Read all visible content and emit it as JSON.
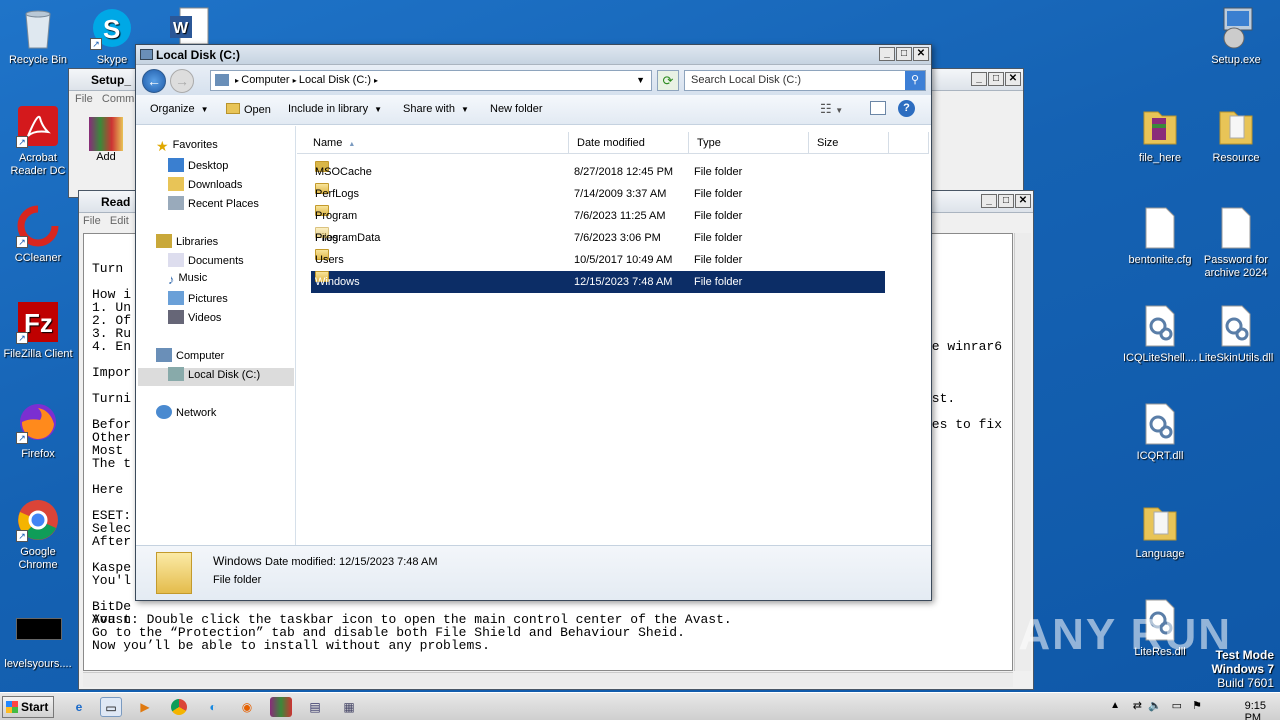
{
  "desktop_icons_left": [
    {
      "label": "Recycle Bin",
      "icon": "recycle-bin-icon"
    },
    {
      "label": "Acrobat Reader DC",
      "icon": "acrobat-icon"
    },
    {
      "label": "CCleaner",
      "icon": "ccleaner-icon"
    },
    {
      "label": "FileZilla Client",
      "icon": "filezilla-icon"
    },
    {
      "label": "Firefox",
      "icon": "firefox-icon"
    },
    {
      "label": "Google Chrome",
      "icon": "chrome-icon"
    },
    {
      "label": "levelsyours....",
      "icon": "black-file-icon"
    }
  ],
  "desktop_icons_top": [
    {
      "label": "Skype",
      "icon": "skype-icon"
    }
  ],
  "desktop_icons_right": [
    {
      "label": "Setup.exe",
      "icon": "setup-icon"
    },
    {
      "label": "file_here",
      "icon": "winrar-folder-icon"
    },
    {
      "label": "Resource",
      "icon": "folder-icon"
    },
    {
      "label": "bentonite.cfg",
      "icon": "file-icon"
    },
    {
      "label": "Password for archive 2024",
      "icon": "file-icon"
    },
    {
      "label": "ICQLiteShell....",
      "icon": "dll-icon"
    },
    {
      "label": "LiteSkinUtils.dll",
      "icon": "dll-icon"
    },
    {
      "label": "ICQRT.dll",
      "icon": "dll-icon"
    },
    {
      "label": "Language",
      "icon": "folder-icon"
    },
    {
      "label": "LiteRes.dll",
      "icon": "dll-icon"
    }
  ],
  "setup_window": {
    "title": "Setup_",
    "menu": [
      "File",
      "Comm"
    ],
    "add_label": "Add"
  },
  "notepad": {
    "title": "Read",
    "menu": [
      "File",
      "Edit"
    ],
    "lines_left": [
      "Turn",
      "",
      "How i",
      "1. Un",
      "2. Of",
      "3. Ru",
      "4. En",
      "",
      "Impor",
      "",
      "Turni",
      "",
      "Befor",
      "Other",
      "Most ",
      "The t",
      "",
      "Here ",
      "",
      "ESET:",
      "Selec",
      "After",
      "",
      "Kaspe",
      "You'l",
      "",
      "BitDe",
      "You n"
    ],
    "frag_right_1": "le winrar6",
    "frag_right_2": "rst.",
    "frag_right_3": "tes to fix",
    "bottom_lines": [
      "Avast: Double click the taskbar icon to open the main control center of the Avast.",
      "Go to the “Protection” tab and disable both File Shield and Behaviour Sheid.",
      "Now you’ll be able to install without any problems."
    ]
  },
  "explorer": {
    "title": "Local Disk (C:)",
    "breadcrumb": [
      "Computer",
      "Local Disk (C:)"
    ],
    "search_placeholder": "Search Local Disk (C:)",
    "toolbar": {
      "organize": "Organize",
      "open": "Open",
      "include": "Include in library",
      "share": "Share with",
      "new_folder": "New folder"
    },
    "nav": {
      "favorites": "Favorites",
      "desktop": "Desktop",
      "downloads": "Downloads",
      "recent": "Recent Places",
      "libraries": "Libraries",
      "documents": "Documents",
      "music": "Music",
      "pictures": "Pictures",
      "videos": "Videos",
      "computer": "Computer",
      "localdisk": "Local Disk (C:)",
      "network": "Network"
    },
    "columns": [
      "Name",
      "Date modified",
      "Type",
      "Size"
    ],
    "rows": [
      {
        "name": "MSOCache",
        "date": "8/27/2018 12:45 PM",
        "type": "File folder"
      },
      {
        "name": "PerfLogs",
        "date": "7/14/2009 3:37 AM",
        "type": "File folder"
      },
      {
        "name": "Program Files",
        "date": "7/6/2023 11:25 AM",
        "type": "File folder"
      },
      {
        "name": "ProgramData",
        "date": "7/6/2023 3:06 PM",
        "type": "File folder"
      },
      {
        "name": "Users",
        "date": "10/5/2017 10:49 AM",
        "type": "File folder"
      },
      {
        "name": "Windows",
        "date": "12/15/2023 7:48 AM",
        "type": "File folder"
      }
    ],
    "details": {
      "name": "Windows",
      "modified": "Date modified: 12/15/2023 7:48 AM",
      "type": "File folder"
    }
  },
  "taskbar": {
    "start": "Start",
    "clock": "9:15 PM"
  },
  "watermark": "ANY RUN",
  "testmode": {
    "line1": "Test Mode",
    "line2": "Windows 7",
    "line3": "Build 7601"
  }
}
